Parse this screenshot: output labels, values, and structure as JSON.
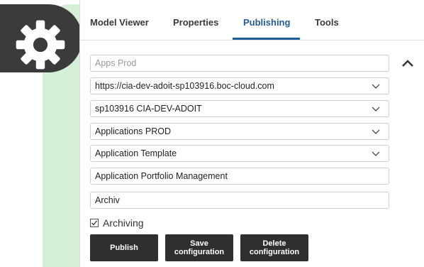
{
  "tabs": [
    {
      "label": "Model Viewer"
    },
    {
      "label": "Properties"
    },
    {
      "label": "Publishing"
    },
    {
      "label": "Tools"
    }
  ],
  "active_tab": "Publishing",
  "fields": {
    "app_name": {
      "placeholder": "Apps Prod"
    },
    "server_url": {
      "value": "https://cia-dev-adoit-sp103916.boc-cloud.com"
    },
    "repository": {
      "value": "sp103916 CIA-DEV-ADOIT"
    },
    "environment": {
      "value": "Applications PROD"
    },
    "template": {
      "value": "Application Template"
    },
    "model_name": {
      "value": "Application Portfolio Management"
    },
    "archive_folder": {
      "value": "Archiv"
    }
  },
  "archiving": {
    "label": "Archiving",
    "checked": true
  },
  "buttons": {
    "publish": "Publish",
    "save_line1": "Save",
    "save_line2": "configuration",
    "delete_line1": "Delete",
    "delete_line2": "configuration"
  },
  "icons": {
    "settings": "gear-icon",
    "collapse": "chevron-up-icon",
    "dropdown": "chevron-down-icon",
    "check": "check-icon"
  },
  "colors": {
    "accent": "#1f5c9a",
    "button_bg": "#2f2f2f",
    "backdrop_green": "#d4f0d6",
    "badge_bg": "#3b3b3b"
  }
}
